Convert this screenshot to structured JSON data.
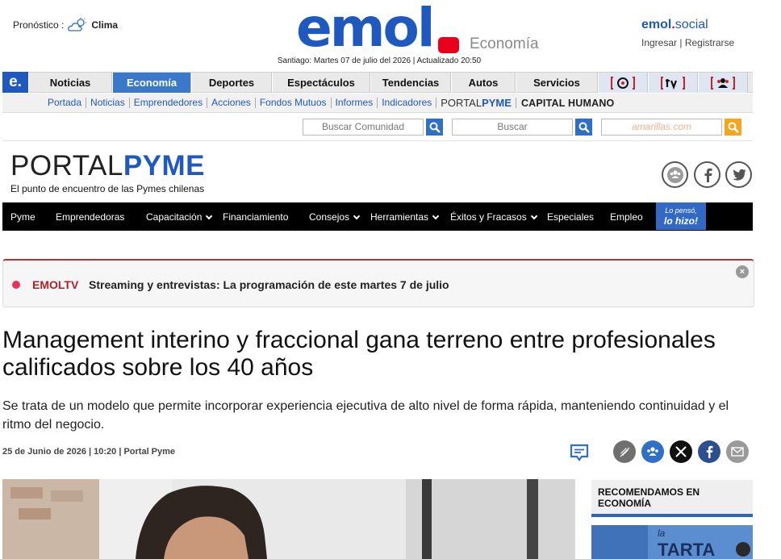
{
  "header": {
    "forecast_label": "Pronóstico :",
    "forecast_link": "Clima",
    "logo_text": "emol",
    "section": "Economía",
    "dateline": "Santiago: Martes 07 de julio del 2026 | Actualizado 20:50",
    "social_logo_a": "emol",
    "social_logo_b": "social",
    "login": "Ingresar",
    "register": "Registrarse"
  },
  "main_nav": {
    "logo": "e.",
    "items": [
      "Noticias",
      "Economía",
      "Deportes",
      "Espectáculos",
      "Tendencias",
      "Autos",
      "Servicios"
    ],
    "active": "Economía"
  },
  "sub_nav": {
    "links": [
      "Portada",
      "Noticias",
      "Emprendedores",
      "Acciones",
      "Fondos Mutuos",
      "Informes",
      "Indicadores"
    ],
    "portal_a": "PORTAL",
    "portal_b": "PYME",
    "capital": "CAPITAL HUMANO"
  },
  "search": {
    "community_placeholder": "Buscar Comunidad",
    "search_placeholder": "Buscar",
    "amarillas_placeholder": "amarillas.com"
  },
  "portal": {
    "logo_a": "PORTAL",
    "logo_b": "PYME",
    "tagline": "El punto de encuentro de las Pymes chilenas"
  },
  "pyme_nav": {
    "items": [
      "Pyme",
      "Emprendedoras",
      "Capacitación",
      "Financiamiento",
      "Consejos",
      "Herramientas",
      "Éxitos y Fracasos",
      "Especiales",
      "Empleo"
    ],
    "lohizo_a": "Lo pensó,",
    "lohizo_b": "lo hizo!"
  },
  "banner": {
    "label": "EMOLTV",
    "text": "Streaming y entrevistas: La programación de este martes 7 de julio"
  },
  "article": {
    "headline": "Management interino y fraccional gana terreno entre profesionales calificados sobre los 40 años",
    "lead": "Se trata de un modelo que permite incorporar experiencia ejecutiva de alto nivel de forma rápida, manteniendo continuidad y el ritmo del negocio.",
    "byline": "25 de Junio de 2026 | 10:20 | Portal Pyme"
  },
  "sidebar": {
    "reco_title": "RECOMENDAMOS EN ECONOMÍA",
    "reco_image_text": "la TARTA"
  },
  "colors": {
    "brand_blue": "#1f58bf",
    "brand_red": "#e8001c",
    "nav_active": "#3a78c9"
  }
}
